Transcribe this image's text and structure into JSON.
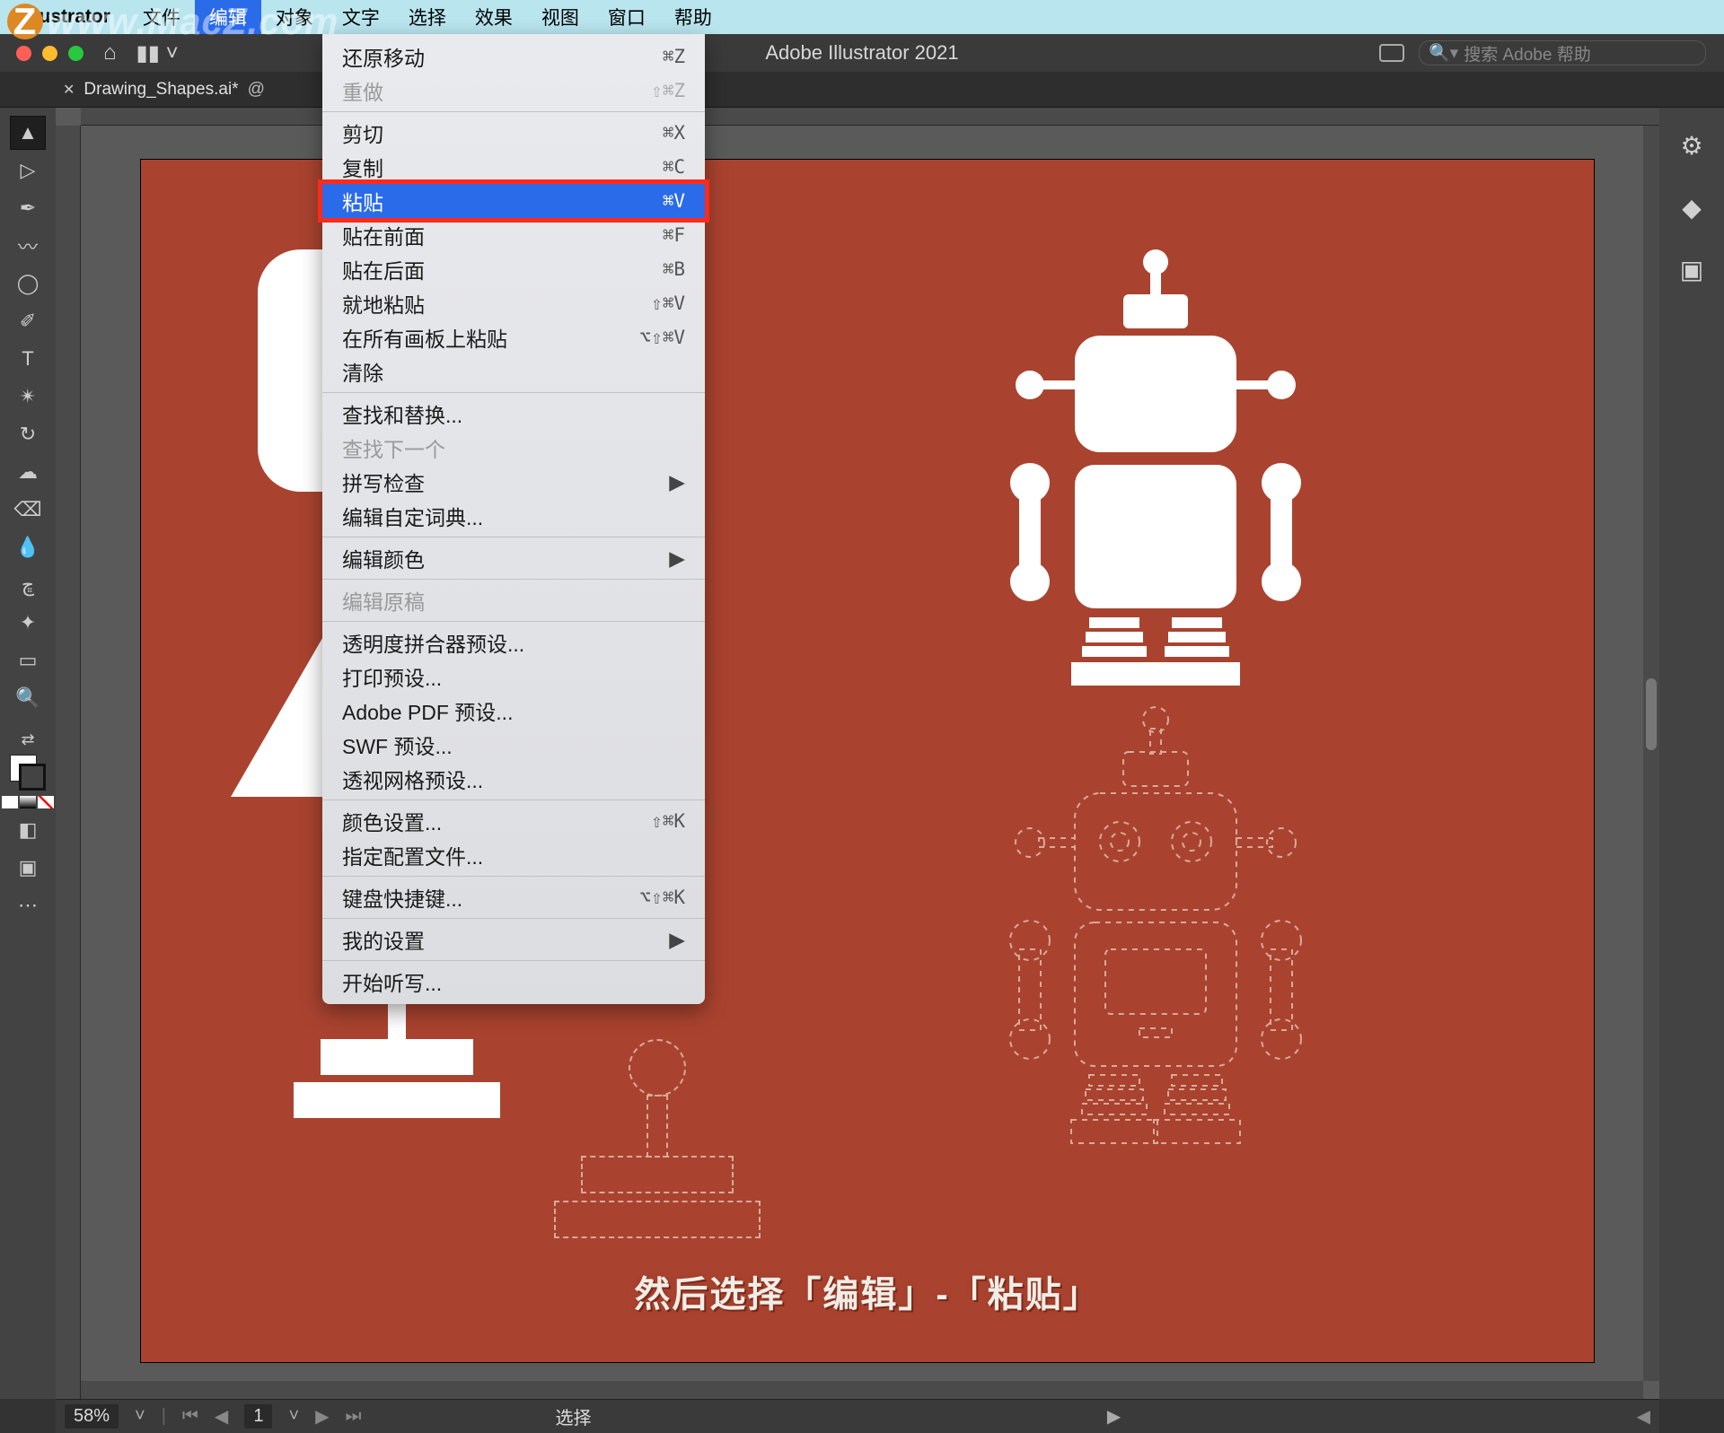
{
  "watermark": "www.MacZ.com",
  "mac_menu": {
    "app": "Illustrator",
    "items": [
      "文件",
      "编辑",
      "对象",
      "文字",
      "选择",
      "效果",
      "视图",
      "窗口",
      "帮助"
    ],
    "active_index": 1
  },
  "titlebar": {
    "title": "Adobe Illustrator 2021",
    "search_placeholder": "搜索 Adobe 帮助"
  },
  "tab": {
    "name": "Drawing_Shapes.ai*"
  },
  "dropdown": {
    "groups": [
      [
        {
          "label": "还原移动",
          "shortcut": "⌘Z"
        },
        {
          "label": "重做",
          "shortcut": "⇧⌘Z",
          "disabled": true
        }
      ],
      [
        {
          "label": "剪切",
          "shortcut": "⌘X"
        },
        {
          "label": "复制",
          "shortcut": "⌘C"
        },
        {
          "label": "粘贴",
          "shortcut": "⌘V",
          "highlight": true
        },
        {
          "label": "贴在前面",
          "shortcut": "⌘F"
        },
        {
          "label": "贴在后面",
          "shortcut": "⌘B"
        },
        {
          "label": "就地粘贴",
          "shortcut": "⇧⌘V"
        },
        {
          "label": "在所有画板上粘贴",
          "shortcut": "⌥⇧⌘V"
        },
        {
          "label": "清除",
          "shortcut": ""
        }
      ],
      [
        {
          "label": "查找和替换...",
          "shortcut": ""
        },
        {
          "label": "查找下一个",
          "shortcut": "",
          "disabled": true
        },
        {
          "label": "拼写检查",
          "submenu": true
        },
        {
          "label": "编辑自定词典...",
          "shortcut": ""
        }
      ],
      [
        {
          "label": "编辑颜色",
          "submenu": true
        }
      ],
      [
        {
          "label": "编辑原稿",
          "shortcut": "",
          "disabled": true
        }
      ],
      [
        {
          "label": "透明度拼合器预设...",
          "shortcut": ""
        },
        {
          "label": "打印预设...",
          "shortcut": ""
        },
        {
          "label": "Adobe PDF 预设...",
          "shortcut": ""
        },
        {
          "label": "SWF 预设...",
          "shortcut": ""
        },
        {
          "label": "透视网格预设...",
          "shortcut": ""
        }
      ],
      [
        {
          "label": "颜色设置...",
          "shortcut": "⇧⌘K"
        },
        {
          "label": "指定配置文件...",
          "shortcut": ""
        }
      ],
      [
        {
          "label": "键盘快捷键...",
          "shortcut": "⌥⇧⌘K"
        }
      ],
      [
        {
          "label": "我的设置",
          "submenu": true
        }
      ],
      [
        {
          "label": "开始听写...",
          "shortcut": ""
        }
      ]
    ]
  },
  "status": {
    "zoom": "58%",
    "artboard": "1",
    "mode": "选择"
  },
  "caption": "然后选择「编辑」-「粘贴」",
  "colors": {
    "artboard_bg": "#a9432f",
    "highlight_outline": "#ff2a1a",
    "menu_active": "#2a6bea"
  }
}
